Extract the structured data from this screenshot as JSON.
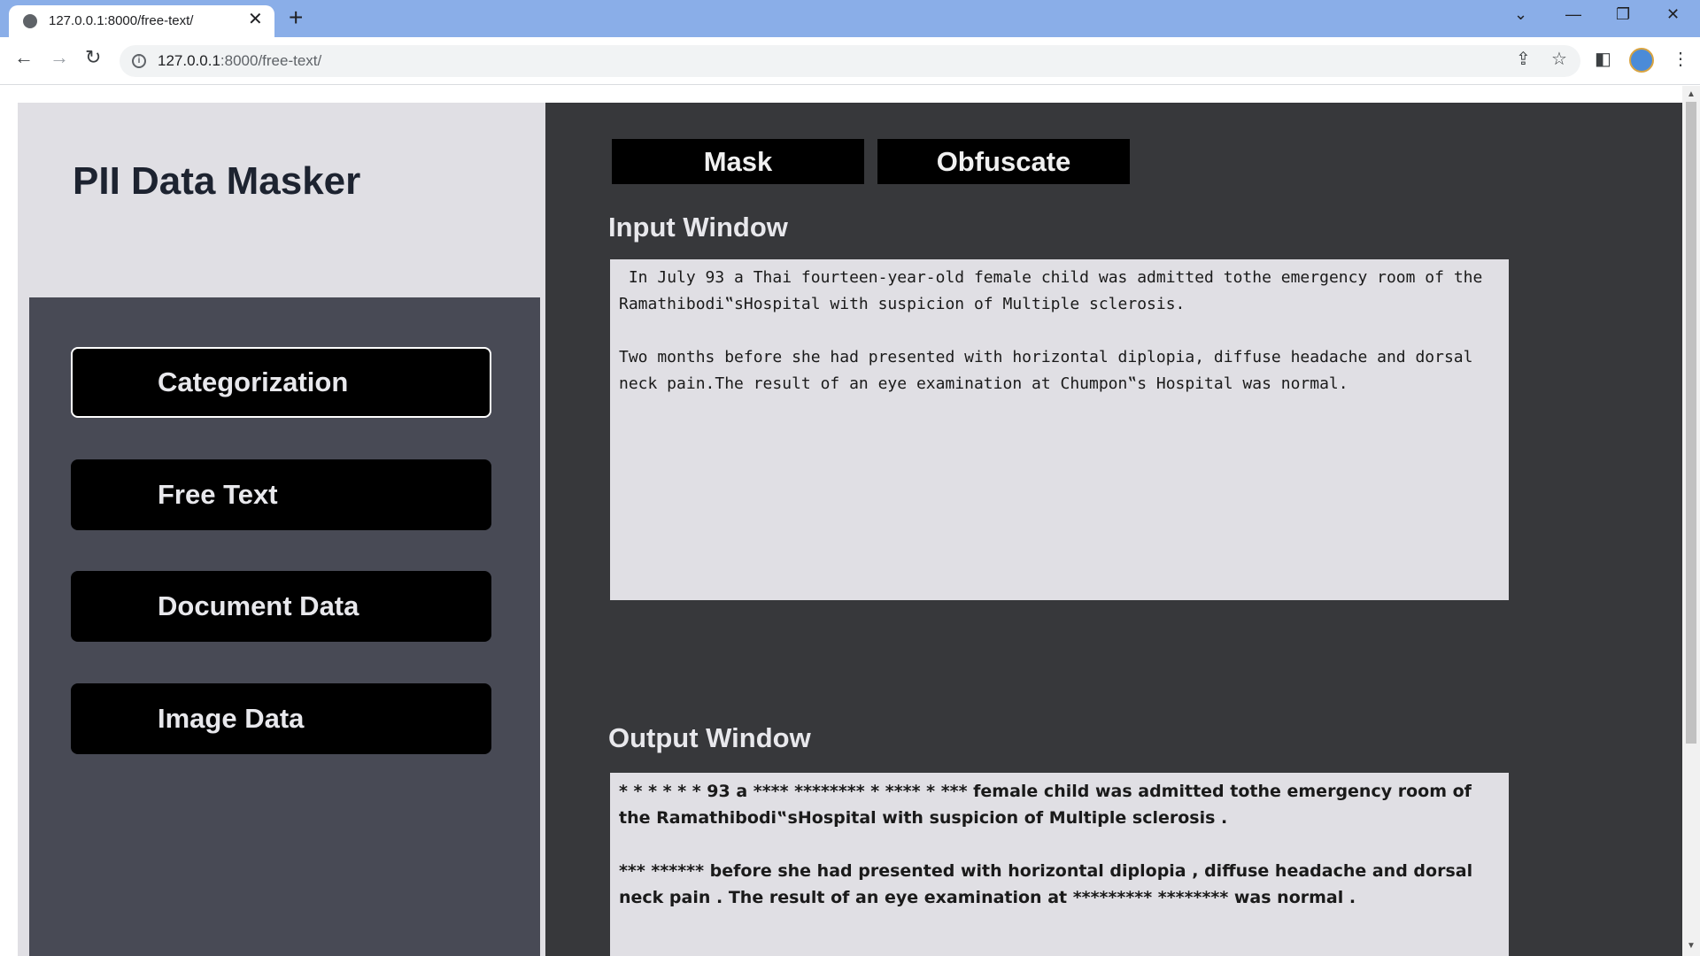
{
  "browser": {
    "tab_title": "127.0.0.1:8000/free-text/",
    "url_host": "127.0.0.1",
    "url_rest": ":8000/free-text/"
  },
  "app": {
    "title": "PII Data Masker"
  },
  "sidebar": {
    "items": [
      {
        "label": "Categorization",
        "active": true
      },
      {
        "label": "Free Text",
        "active": false
      },
      {
        "label": "Document Data",
        "active": false
      },
      {
        "label": "Image Data",
        "active": false
      }
    ]
  },
  "actions": {
    "mask_label": "Mask",
    "obfuscate_label": "Obfuscate"
  },
  "input_window": {
    "label": "Input Window",
    "text": " In July 93 a Thai fourteen-year-old female child was admitted tothe emergency room of the Ramathibodi‟sHospital with suspicion of Multiple sclerosis.\n\nTwo months before she had presented with horizontal diplopia, diffuse headache and dorsal neck pain.The result of an eye examination at Chumpon‟s Hospital was normal."
  },
  "output_window": {
    "label": "Output Window",
    "text": "* * * * * * 93 a **** ******** * **** * *** female child was admitted tothe emergency room of the Ramathibodi‟sHospital with suspicion of Multiple sclerosis .\n\n*** ****** before she had presented with horizontal diplopia , diffuse headache and dorsal neck pain . The result of an eye examination at ********* ******** was normal ."
  },
  "colors": {
    "sidebar_bg": "#e0dfe4",
    "nav_bg": "#484a55",
    "main_bg": "#37383b",
    "button_bg": "#000000"
  }
}
